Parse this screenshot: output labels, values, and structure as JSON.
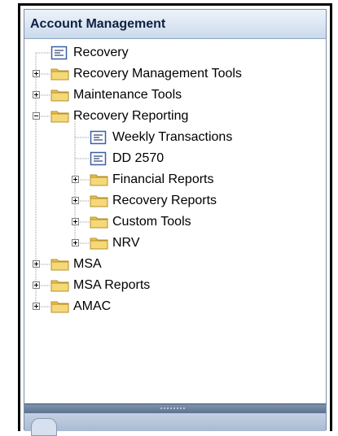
{
  "panel": {
    "title": "Account Management"
  },
  "tree": {
    "items": [
      {
        "label": "Recovery",
        "type": "page",
        "level": 0
      },
      {
        "label": "Recovery Management Tools",
        "type": "folder",
        "level": 0,
        "state": "collapsed"
      },
      {
        "label": "Maintenance Tools",
        "type": "folder",
        "level": 0,
        "state": "collapsed"
      },
      {
        "label": "Recovery Reporting",
        "type": "folder",
        "level": 0,
        "state": "expanded"
      },
      {
        "label": "Weekly Transactions",
        "type": "page",
        "level": 1
      },
      {
        "label": "DD 2570",
        "type": "page",
        "level": 1
      },
      {
        "label": "Financial Reports",
        "type": "folder",
        "level": 1,
        "state": "collapsed"
      },
      {
        "label": "Recovery Reports",
        "type": "folder",
        "level": 1,
        "state": "collapsed"
      },
      {
        "label": "Custom Tools",
        "type": "folder",
        "level": 1,
        "state": "collapsed"
      },
      {
        "label": "NRV",
        "type": "folder",
        "level": 1,
        "state": "collapsed"
      },
      {
        "label": "MSA",
        "type": "folder",
        "level": 0,
        "state": "collapsed"
      },
      {
        "label": "MSA Reports",
        "type": "folder",
        "level": 0,
        "state": "collapsed"
      },
      {
        "label": "AMAC",
        "type": "folder",
        "level": 0,
        "state": "collapsed"
      }
    ]
  },
  "colors": {
    "folder_fill": "#f5d878",
    "folder_tab": "#e9c24f",
    "folder_stroke": "#b8902a",
    "page_icon_border": "#3a5fa8",
    "header_text": "#102040"
  }
}
